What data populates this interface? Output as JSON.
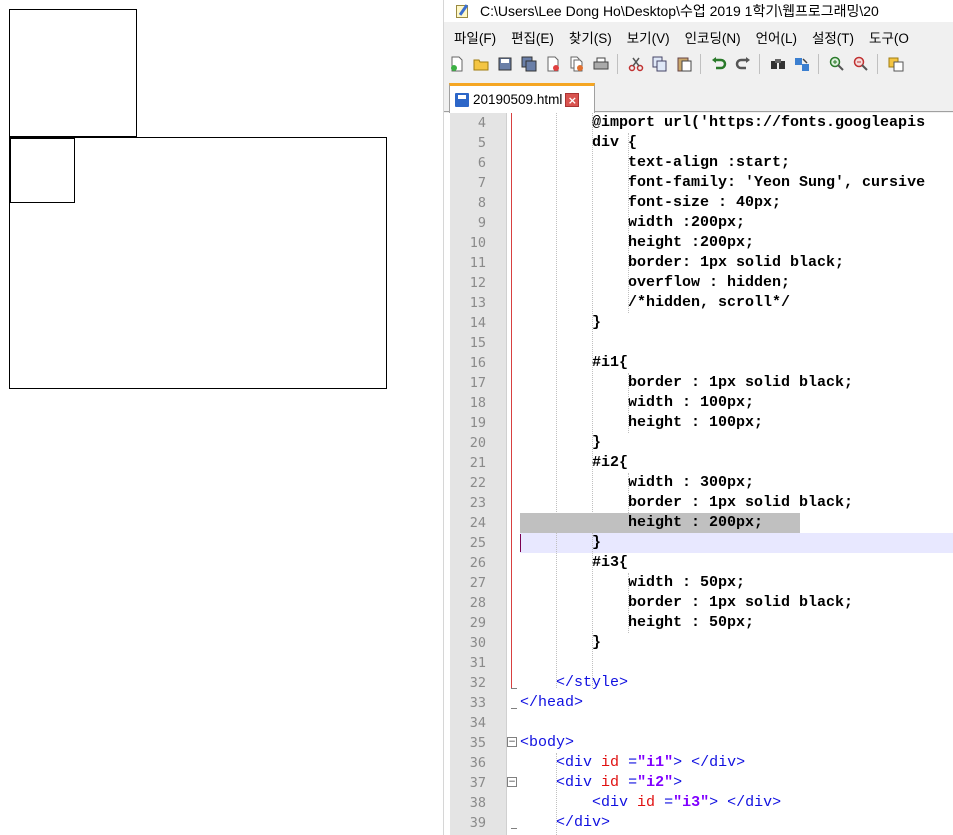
{
  "editor": {
    "title": "C:\\Users\\Lee Dong Ho\\Desktop\\수업 2019 1학기\\웹프로그래밍\\20",
    "menu": [
      "파일(F)",
      "편집(E)",
      "찾기(S)",
      "보기(V)",
      "인코딩(N)",
      "언어(L)",
      "설정(T)",
      "도구(O"
    ],
    "toolbar_icons": [
      "new-file-icon",
      "open-file-icon",
      "save-icon",
      "save-all-icon",
      "close-icon",
      "close-all-icon",
      "print-icon",
      "cut-icon",
      "copy-icon",
      "paste-icon",
      "undo-icon",
      "redo-icon",
      "find-icon",
      "replace-icon",
      "zoom-in-icon",
      "zoom-out-icon",
      "sync-icon"
    ],
    "tab": {
      "label": "20190509.html",
      "close": "×"
    },
    "lines": [
      {
        "n": "4",
        "text": "@import url('https://fonts.googleapis"
      },
      {
        "n": "5",
        "text": "div {"
      },
      {
        "n": "6",
        "text": "    text-align :start;"
      },
      {
        "n": "7",
        "text": "    font-family: 'Yeon Sung', cursive"
      },
      {
        "n": "8",
        "text": "    font-size : 40px;"
      },
      {
        "n": "9",
        "text": "    width :200px;"
      },
      {
        "n": "10",
        "text": "    height :200px;"
      },
      {
        "n": "11",
        "text": "    border: 1px solid black;"
      },
      {
        "n": "12",
        "text": "    overflow : hidden;"
      },
      {
        "n": "13",
        "text": "    /*hidden, scroll*/"
      },
      {
        "n": "14",
        "text": "}"
      },
      {
        "n": "15",
        "text": ""
      },
      {
        "n": "16",
        "text": "#i1{"
      },
      {
        "n": "17",
        "text": "    border : 1px solid black;"
      },
      {
        "n": "18",
        "text": "    width : 100px;"
      },
      {
        "n": "19",
        "text": "    height : 100px;"
      },
      {
        "n": "20",
        "text": "}"
      },
      {
        "n": "21",
        "text": "#i2{"
      },
      {
        "n": "22",
        "text": "    width : 300px;"
      },
      {
        "n": "23",
        "text": "    border : 1px solid black;"
      },
      {
        "n": "24",
        "text": "    height : 200px;"
      },
      {
        "n": "25",
        "text": "}"
      },
      {
        "n": "26",
        "text": "#i3{"
      },
      {
        "n": "27",
        "text": "    width : 50px;"
      },
      {
        "n": "28",
        "text": "    border : 1px solid black;"
      },
      {
        "n": "29",
        "text": "    height : 50px;"
      },
      {
        "n": "30",
        "text": "}"
      },
      {
        "n": "31",
        "text": ""
      },
      {
        "n": "32",
        "text": "</style>"
      },
      {
        "n": "33",
        "text": "</head>"
      },
      {
        "n": "34",
        "text": ""
      },
      {
        "n": "35",
        "text": "<body>"
      },
      {
        "n": "36",
        "text": "<div id =\"i1\"> </div>"
      },
      {
        "n": "37",
        "text": "<div id =\"i2\">"
      },
      {
        "n": "38",
        "text": "<div id =\"i3\"> </div>"
      },
      {
        "n": "39",
        "text": "</div>"
      }
    ]
  },
  "colors": {
    "tag": "#1010e0",
    "attribute": "#e01010",
    "string": "#8000ff",
    "line_number": "#8a8a8a",
    "gutter_bg": "#e4e4e4",
    "current_line": "#e8e8ff",
    "selection": "#c0c0c0",
    "tab_accent": "#f5a623"
  }
}
